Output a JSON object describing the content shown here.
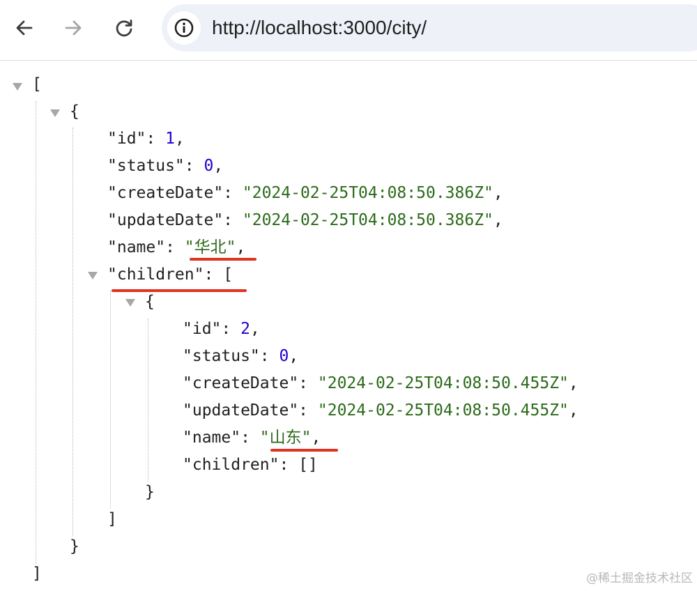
{
  "browser": {
    "url": "http://localhost:3000/city/",
    "icons": {
      "back": "arrow-left-icon",
      "forward": "arrow-right-icon",
      "reload": "reload-icon",
      "site_info": "info-icon"
    }
  },
  "json": {
    "open_array": "[",
    "close_array": "]",
    "open_object": "{",
    "close_object": "}",
    "root": {
      "id": {
        "key": "\"id\"",
        "value": "1"
      },
      "status": {
        "key": "\"status\"",
        "value": "0"
      },
      "createDate": {
        "key": "\"createDate\"",
        "value": "\"2024-02-25T04:08:50.386Z\""
      },
      "updateDate": {
        "key": "\"updateDate\"",
        "value": "\"2024-02-25T04:08:50.386Z\""
      },
      "name": {
        "key": "\"name\"",
        "value": "\"华北\""
      },
      "children": {
        "key": "\"children\""
      }
    },
    "child": {
      "id": {
        "key": "\"id\"",
        "value": "2"
      },
      "status": {
        "key": "\"status\"",
        "value": "0"
      },
      "createDate": {
        "key": "\"createDate\"",
        "value": "\"2024-02-25T04:08:50.455Z\""
      },
      "updateDate": {
        "key": "\"updateDate\"",
        "value": "\"2024-02-25T04:08:50.455Z\""
      },
      "name": {
        "key": "\"name\"",
        "value": "\"山东\""
      },
      "children": {
        "key": "\"children\"",
        "value": "[]"
      }
    }
  },
  "colors": {
    "string": "#2b6a1a",
    "number": "#1c00cf",
    "highlight": "#e0321d"
  },
  "watermark": "@稀土掘金技术社区"
}
